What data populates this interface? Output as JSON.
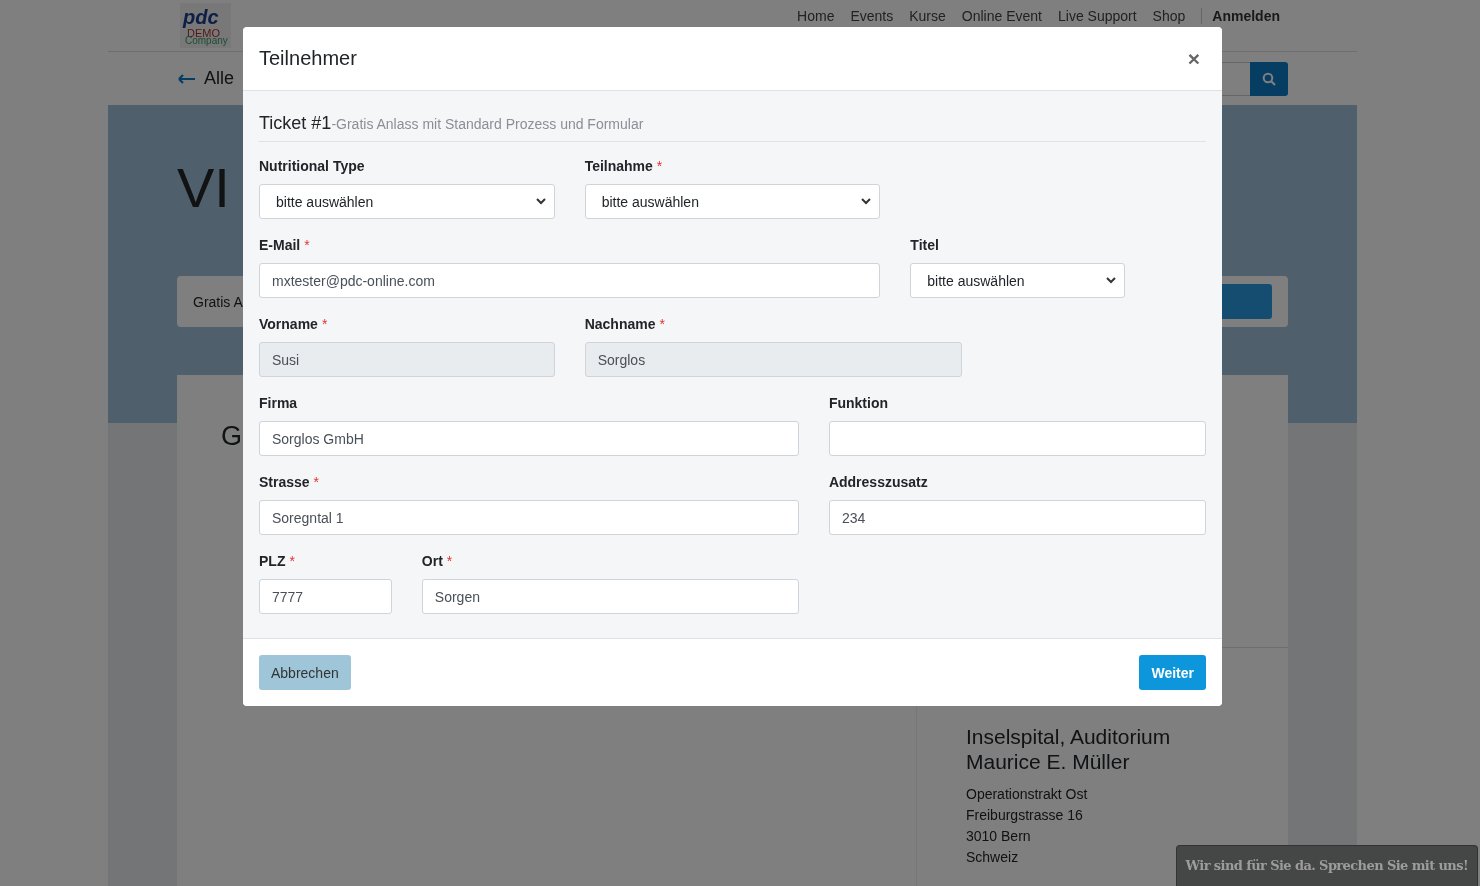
{
  "page": {
    "logo": {
      "brand": "pdc",
      "line2": "DEMO",
      "line3": "Company"
    },
    "nav": [
      "Home",
      "Events",
      "Kurse",
      "Online Event",
      "Live Support",
      "Shop"
    ],
    "login": "Anmelden",
    "back_link": "Alle",
    "hero_title": "VI",
    "ticket_card": "Gratis A",
    "section_title": "G",
    "venue": {
      "name": "Inselspital, Auditorium Maurice E. Müller",
      "address": [
        "Operationstrakt Ost",
        "Freiburgstrasse 16",
        "3010 Bern",
        "Schweiz"
      ]
    }
  },
  "modal": {
    "title": "Teilnehmer",
    "close": "×",
    "ticket": "Ticket #1",
    "ticket_subtitle": "-Gratis Anlass mit Standard Prozess und Formular",
    "rows": [
      [
        {
          "label": "Nutritional Type",
          "kind": "select",
          "value": "bitte auswählen"
        },
        {
          "label": "Teilnahme",
          "required_mark": "*",
          "kind": "select",
          "value": "bitte auswählen"
        }
      ],
      [
        {
          "label": "E-Mail",
          "required_mark": "*",
          "kind": "text",
          "value": "mxtester@pdc-online.com",
          "disabled": false
        },
        {
          "label": "Titel",
          "kind": "select",
          "value": "bitte auswählen"
        }
      ],
      [
        {
          "label": "Vorname",
          "required_mark": "*",
          "kind": "text",
          "value": "Susi",
          "disabled": true
        },
        {
          "label": "Nachname",
          "required_mark": "*",
          "kind": "text",
          "value": "Sorglos",
          "disabled": true
        }
      ],
      [
        {
          "label": "Firma",
          "kind": "text",
          "value": "Sorglos GmbH",
          "disabled": false
        },
        {
          "label": "Funktion",
          "kind": "text",
          "disabled": false
        }
      ],
      [
        {
          "label": "Strasse",
          "required_mark": "*",
          "kind": "text",
          "value": "Soregntal 1",
          "disabled": false
        },
        {
          "label": "Addresszusatz",
          "kind": "text",
          "value": "234",
          "disabled": false
        }
      ],
      [
        {
          "label": "PLZ",
          "required_mark": "*",
          "kind": "text",
          "value": "7777",
          "disabled": false
        },
        {
          "label": "Ort",
          "required_mark": "*",
          "kind": "text",
          "value": "Sorgen",
          "disabled": false
        }
      ]
    ],
    "buttons": [
      {
        "label": "Abbrechen",
        "kind": "secondary"
      },
      {
        "label": "Weiter",
        "kind": "primary"
      }
    ]
  },
  "chat": "Wir sind für Sie da. Sprechen Sie mit uns!"
}
